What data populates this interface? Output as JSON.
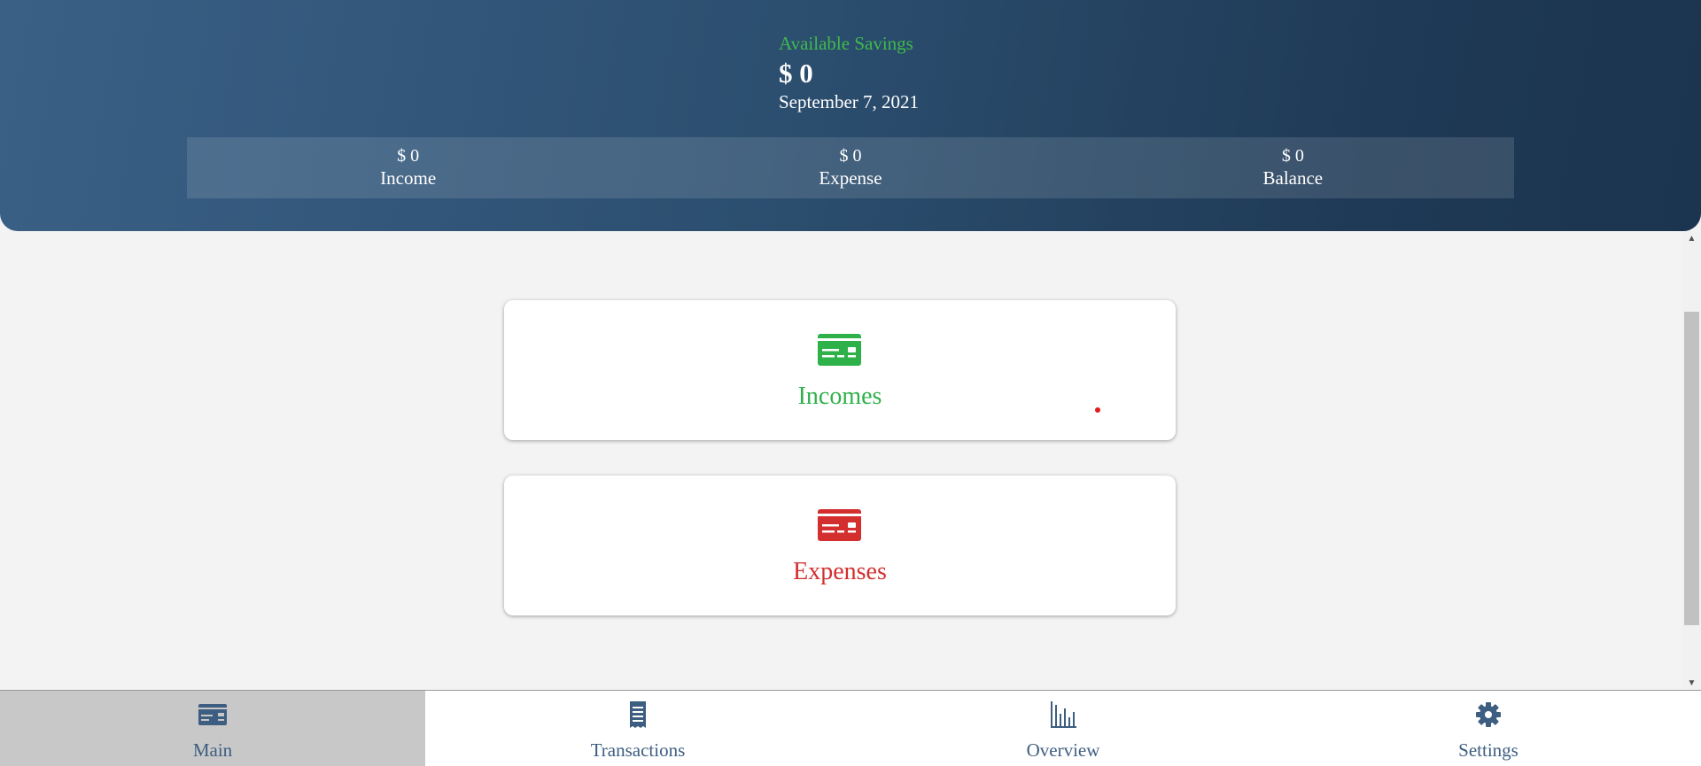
{
  "header": {
    "savings_label": "Available Savings",
    "savings_amount": "$ 0",
    "date": "September 7, 2021",
    "summary": [
      {
        "value": "$ 0",
        "label": "Income"
      },
      {
        "value": "$ 0",
        "label": "Expense"
      },
      {
        "value": "$ 0",
        "label": "Balance"
      }
    ]
  },
  "cards": {
    "incomes": {
      "label": "Incomes",
      "icon": "credit-card-icon",
      "color": "#2fb14a"
    },
    "expenses": {
      "label": "Expenses",
      "icon": "credit-card-icon",
      "color": "#d32f2f"
    }
  },
  "nav": {
    "items": [
      {
        "label": "Main",
        "icon": "credit-card-icon",
        "active": true
      },
      {
        "label": "Transactions",
        "icon": "receipt-icon",
        "active": false
      },
      {
        "label": "Overview",
        "icon": "bar-chart-icon",
        "active": false
      },
      {
        "label": "Settings",
        "icon": "gear-icon",
        "active": false
      }
    ]
  },
  "colors": {
    "header_dark": "#1b3450",
    "header_light": "#3a6086",
    "accent_green": "#3fba4c",
    "nav_text": "#3d5e80"
  }
}
